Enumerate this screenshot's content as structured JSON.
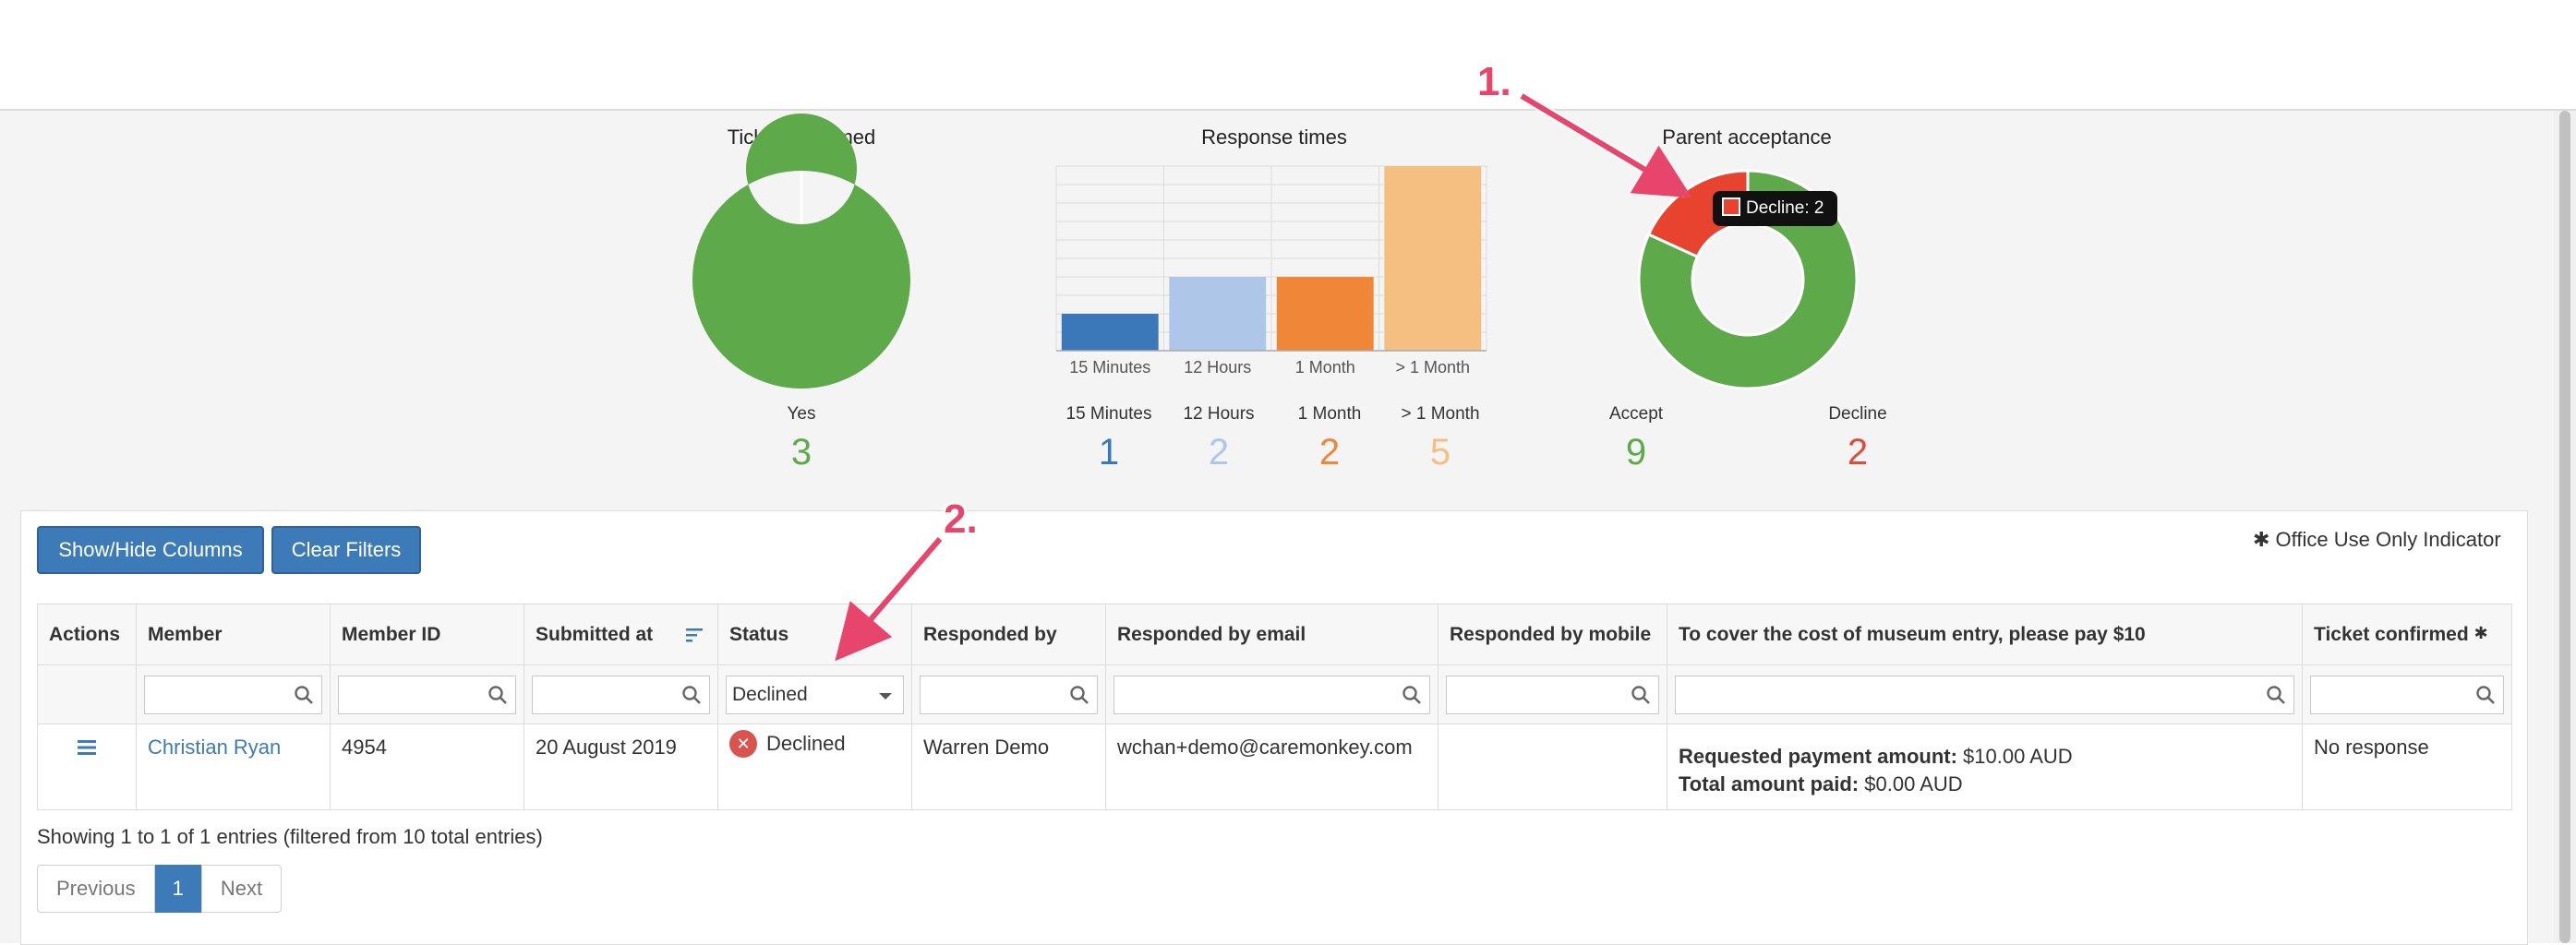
{
  "stats": {
    "ticket": {
      "title": "Ticket confirmed",
      "label": "Yes",
      "value": "3",
      "color": "#5ea94a"
    },
    "response": {
      "title": "Response times",
      "items": [
        {
          "label": "15 Minutes",
          "value": "1",
          "color": "#3a78b9"
        },
        {
          "label": "12 Hours",
          "value": "2",
          "color": "#aec7e8"
        },
        {
          "label": "1 Month",
          "value": "2",
          "color": "#f08637"
        },
        {
          "label": "> 1 Month",
          "value": "5",
          "color": "#f5bf82"
        }
      ]
    },
    "parent": {
      "title": "Parent acceptance",
      "accept_label": "Accept",
      "accept_value": "9",
      "accept_color": "#5ea94a",
      "decline_label": "Decline",
      "decline_value": "2",
      "decline_color": "#e8432f",
      "tooltip": "Decline: 2"
    }
  },
  "chart_data": [
    {
      "type": "pie",
      "title": "Ticket confirmed",
      "categories": [
        "Yes"
      ],
      "values": [
        3
      ]
    },
    {
      "type": "bar",
      "title": "Response times",
      "categories": [
        "15 Minutes",
        "12 Hours",
        "1 Month",
        "> 1 Month"
      ],
      "values": [
        1,
        2,
        2,
        5
      ],
      "ylim": [
        0,
        5
      ],
      "grid": true
    },
    {
      "type": "pie",
      "title": "Parent acceptance",
      "categories": [
        "Accept",
        "Decline"
      ],
      "values": [
        9,
        2
      ]
    }
  ],
  "annotations": {
    "one": "1.",
    "two": "2."
  },
  "toolbar": {
    "show_hide": "Show/Hide Columns",
    "clear_filters": "Clear Filters",
    "office_indicator": "✱ Office Use Only Indicator"
  },
  "table": {
    "headers": {
      "actions": "Actions",
      "member": "Member",
      "member_id": "Member ID",
      "submitted_at": "Submitted at",
      "status": "Status",
      "responded_by": "Responded by",
      "responded_email": "Responded by email",
      "responded_mobile": "Responded by mobile",
      "museum": "To cover the cost of museum entry, please pay $10",
      "ticket_confirmed": "Ticket confirmed",
      "asterisk": "✱"
    },
    "filters": {
      "status_selected": "Declined"
    },
    "row": {
      "member": "Christian Ryan",
      "member_id": "4954",
      "submitted_at": "20 August 2019",
      "status": "Declined",
      "responded_by": "Warren Demo",
      "responded_email": "wchan+demo@caremonkey.com",
      "responded_mobile": "",
      "payment_label": "Requested payment amount:",
      "payment_value": " $10.00 AUD",
      "paid_label": "Total amount paid:",
      "paid_value": " $0.00 AUD",
      "ticket_confirmed": "No response"
    }
  },
  "footer": {
    "showing": "Showing 1 to 1 of 1 entries (filtered from 10 total entries)",
    "previous": "Previous",
    "page": "1",
    "next": "Next"
  }
}
